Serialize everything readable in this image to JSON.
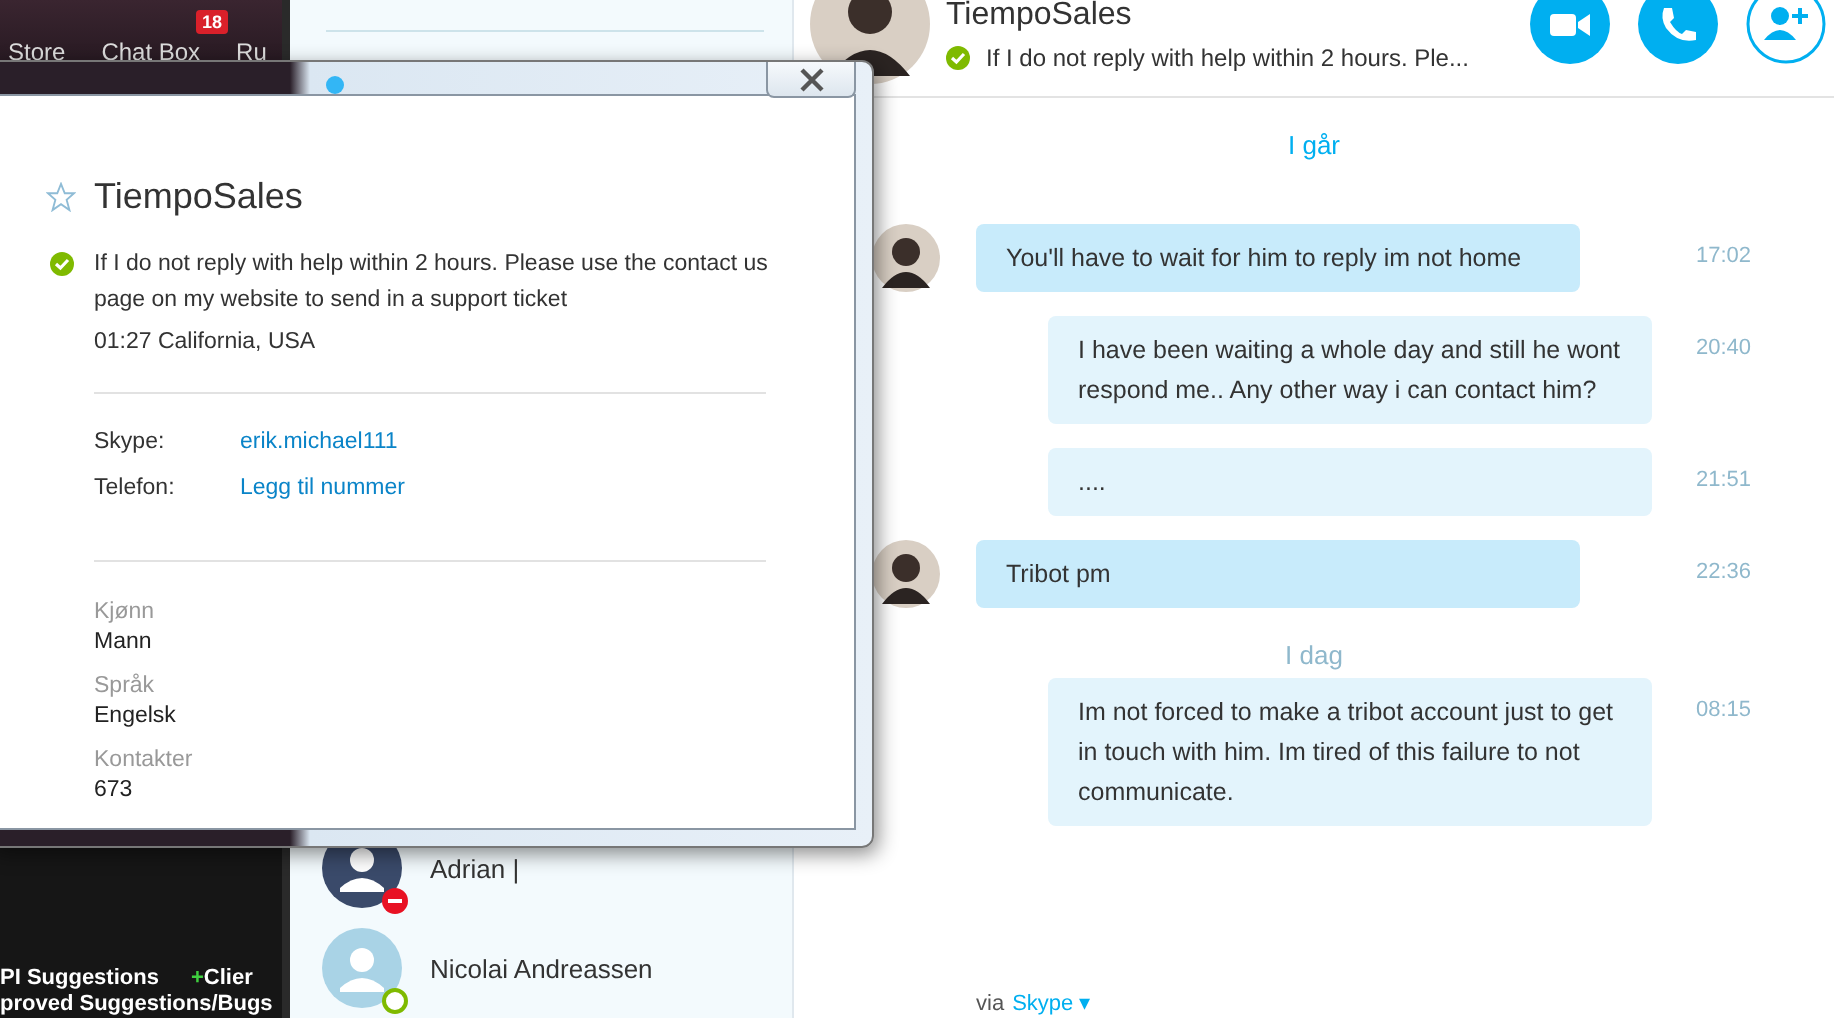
{
  "browser": {
    "nav": [
      {
        "label": "Store"
      },
      {
        "label": "Chat Box",
        "badge": "18"
      },
      {
        "label": "Ru"
      }
    ],
    "forum_links": [
      {
        "label": "PI Suggestions"
      },
      {
        "prefix": "+",
        "label": "Clier"
      },
      {
        "label": "proved Suggestions/Bugs"
      }
    ]
  },
  "contacts": [
    {
      "name": "Adrian |",
      "kind": "busy",
      "color": "#e81123"
    },
    {
      "name": "Nicolai Andreassen",
      "kind": "offline",
      "color": "#7fba00"
    }
  ],
  "chat": {
    "title": "TiempoSales",
    "mood": "If I do not reply with help within 2 hours. Ple...",
    "online": true,
    "messages": [
      {
        "kind": "date",
        "text": "I går"
      },
      {
        "kind": "in",
        "text": "You'll have to wait for him to reply im not home",
        "time": "17:02"
      },
      {
        "kind": "out",
        "text": "I have been waiting a whole day and still he wont respond me.. Any other way i can contact him?",
        "time": "20:40"
      },
      {
        "kind": "out",
        "text": "....",
        "time": "21:51"
      },
      {
        "kind": "in",
        "text": "Tribot pm",
        "time": "22:36"
      },
      {
        "kind": "date",
        "text": "I dag"
      },
      {
        "kind": "out",
        "text": "Im not forced to make a tribot account just to get in touch with him. Im tired of this failure to not communicate.",
        "time": "08:15"
      }
    ],
    "footer": {
      "via": "via",
      "link": "Skype",
      "caret": "▾"
    }
  },
  "profile": {
    "name": "TiempoSales",
    "online": true,
    "mood": "If I do not reply with help within 2 hours. Please use the contact us page on my website to send in a support ticket",
    "location": "01:27 California, USA",
    "contact_fields": [
      {
        "label": "Skype:",
        "value": "erik.michael111"
      },
      {
        "label": "Telefon:",
        "value": "Legg til nummer"
      }
    ],
    "details": [
      {
        "label": "Kjønn",
        "value": "Mann"
      },
      {
        "label": "Språk",
        "value": "Engelsk"
      },
      {
        "label": "Kontakter",
        "value": "673"
      }
    ]
  }
}
